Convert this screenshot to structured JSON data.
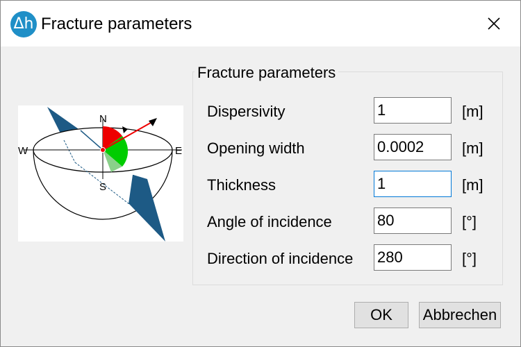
{
  "window": {
    "title": "Fracture parameters",
    "icon_text": "Δh"
  },
  "figure": {
    "labels": {
      "north": "N",
      "south": "S",
      "east": "E",
      "west": "W"
    }
  },
  "group": {
    "label": "Fracture parameters",
    "rows": [
      {
        "label": "Dispersivity",
        "value": "1",
        "unit": "[m]"
      },
      {
        "label": "Opening width",
        "value": "0.0002",
        "unit": "[m]"
      },
      {
        "label": "Thickness",
        "value": "1",
        "unit": "[m]"
      },
      {
        "label": "Angle of incidence",
        "value": "80",
        "unit": "[°]"
      },
      {
        "label": "Direction of incidence",
        "value": "280",
        "unit": "[°]"
      }
    ]
  },
  "buttons": {
    "ok": "OK",
    "cancel": "Abbrechen"
  },
  "colors": {
    "accent": "#0078d7",
    "icon_bg": "#1f8fc7",
    "plane": "#1d5a85",
    "red": "#ee0000",
    "green": "#00cc00"
  }
}
